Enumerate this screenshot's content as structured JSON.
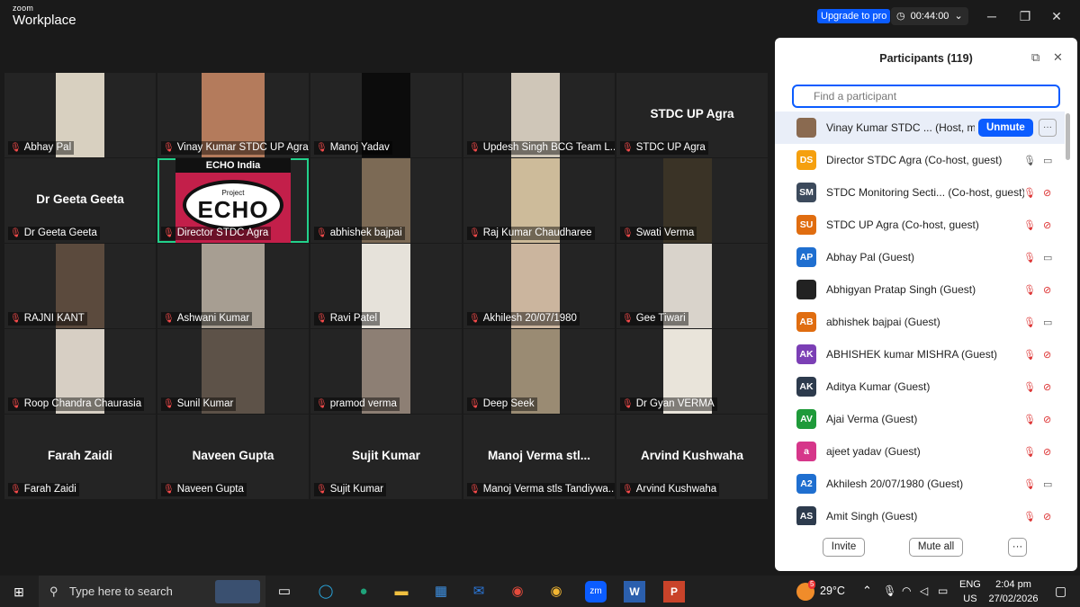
{
  "app": {
    "brand_small": "zoom",
    "brand_large": "Workplace"
  },
  "titlebar": {
    "upgrade": "Upgrade to pro",
    "timer": "00:44:00"
  },
  "tiles": [
    {
      "name": "Abhay Pal",
      "big": "",
      "pic": "#d8d0c0"
    },
    {
      "name": "Vinay Kumar STDC UP Agra",
      "big": "",
      "pic": "#b47b5c"
    },
    {
      "name": "Manoj Yadav",
      "big": "",
      "pic": "#0c0c0c"
    },
    {
      "name": "Updesh Singh  BCG Team L...",
      "big": "",
      "pic": "#cfc6b8"
    },
    {
      "name": "STDC UP Agra",
      "big": "STDC UP Agra",
      "pic": ""
    },
    {
      "name": "Dr Geeta Geeta",
      "big": "Dr Geeta Geeta",
      "pic": ""
    },
    {
      "name": "Director STDC Agra",
      "big": "",
      "pic": "echo"
    },
    {
      "name": "abhishek bajpai",
      "big": "",
      "pic": "#7c6a55"
    },
    {
      "name": "Raj Kumar Chaudharee",
      "big": "",
      "pic": "#cdbb9a"
    },
    {
      "name": "Swati Verma",
      "big": "",
      "pic": "#3a3326"
    },
    {
      "name": "RAJNI KANT",
      "big": "",
      "pic": "#5b4a3d"
    },
    {
      "name": "Ashwani Kumar",
      "big": "",
      "pic": "#a79e92"
    },
    {
      "name": "Ravi Patel",
      "big": "",
      "pic": "#e6e2da"
    },
    {
      "name": "Akhilesh 20/07/1980",
      "big": "",
      "pic": "#cbb59e"
    },
    {
      "name": "Gee Tiwari",
      "big": "",
      "pic": "#d9d3cb"
    },
    {
      "name": "Roop Chandra Chaurasia",
      "big": "",
      "pic": "#d7cfc4"
    },
    {
      "name": "Sunil Kumar",
      "big": "",
      "pic": "#5d5248"
    },
    {
      "name": "pramod verma",
      "big": "",
      "pic": "#8d7f74"
    },
    {
      "name": "Deep Seek",
      "big": "",
      "pic": "#9a8b73"
    },
    {
      "name": "Dr Gyan VERMA",
      "big": "",
      "pic": "#e9e4da"
    },
    {
      "name": "Farah Zaidi",
      "big": "Farah Zaidi",
      "pic": ""
    },
    {
      "name": "Naveen Gupta",
      "big": "Naveen Gupta",
      "pic": ""
    },
    {
      "name": "Sujit Kumar",
      "big": "Sujit Kumar",
      "pic": ""
    },
    {
      "name": "Manoj Verma stls Tandiywa...",
      "big": "Manoj  Verma  stl...",
      "pic": ""
    },
    {
      "name": "Arvind Kushwaha",
      "big": "Arvind Kushwaha",
      "pic": ""
    }
  ],
  "echo_tile": {
    "header": "ECHO India",
    "project": "Project",
    "logo": "ECHO"
  },
  "panel": {
    "title": "Participants (119)",
    "search_placeholder": "Find a participant",
    "unmute": "Unmute",
    "invite": "Invite",
    "mute_all": "Mute all",
    "participants": [
      {
        "initials": "",
        "color": "#8a6a50",
        "name": "Vinay Kumar STDC ...  (Host, me)",
        "mic": "off",
        "cam": ""
      },
      {
        "initials": "DS",
        "color": "#f5a00f",
        "name": "Director STDC Agra (Co-host, guest)",
        "mic": "on",
        "cam": "on"
      },
      {
        "initials": "SM",
        "color": "#3c4a5c",
        "name": "STDC Monitoring Secti...  (Co-host, guest)",
        "mic": "off",
        "cam": "off"
      },
      {
        "initials": "SU",
        "color": "#e06d10",
        "name": "STDC UP Agra (Co-host, guest)",
        "mic": "off",
        "cam": "off"
      },
      {
        "initials": "AP",
        "color": "#1f6fd0",
        "name": "Abhay Pal (Guest)",
        "mic": "off",
        "cam": "on"
      },
      {
        "initials": "",
        "color": "#222222",
        "name": "Abhigyan Pratap Singh (Guest)",
        "mic": "off",
        "cam": "off"
      },
      {
        "initials": "AB",
        "color": "#e06d10",
        "name": "abhishek bajpai (Guest)",
        "mic": "off",
        "cam": "on"
      },
      {
        "initials": "AK",
        "color": "#7b3fb5",
        "name": "ABHISHEK kumar MISHRA (Guest)",
        "mic": "off",
        "cam": "off"
      },
      {
        "initials": "AK",
        "color": "#2d3b4d",
        "name": "Aditya Kumar (Guest)",
        "mic": "off",
        "cam": "off"
      },
      {
        "initials": "AV",
        "color": "#1f9a3a",
        "name": "Ajai Verma (Guest)",
        "mic": "off",
        "cam": "off"
      },
      {
        "initials": "a",
        "color": "#d6368a",
        "name": "ajeet yadav (Guest)",
        "mic": "off",
        "cam": "off"
      },
      {
        "initials": "A2",
        "color": "#1f6fd0",
        "name": "Akhilesh 20/07/1980 (Guest)",
        "mic": "off",
        "cam": "on"
      },
      {
        "initials": "AS",
        "color": "#2d3b4d",
        "name": "Amit Singh (Guest)",
        "mic": "off",
        "cam": "off"
      }
    ]
  },
  "taskbar": {
    "search_placeholder": "Type here to search",
    "weather_badge": "5",
    "temperature": "29°C",
    "lang_top": "ENG",
    "lang_bottom": "US",
    "time": "2:04 pm",
    "date": "27/02/2026"
  },
  "icons": {
    "mic_off": "mic-off-icon",
    "cam_off": "camera-off-icon",
    "popout": "popout-icon",
    "close": "close-icon"
  }
}
